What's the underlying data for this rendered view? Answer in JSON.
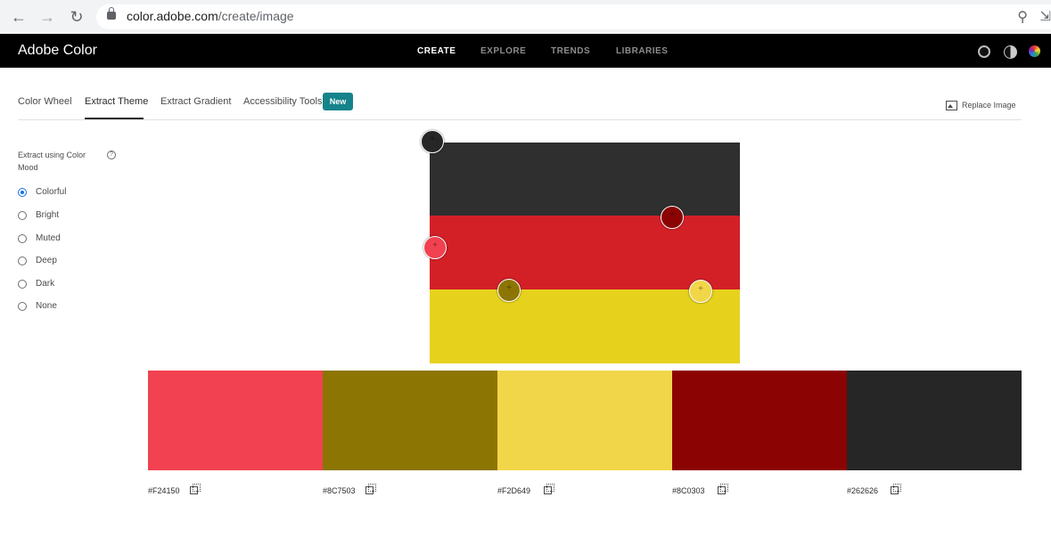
{
  "browser": {
    "url_host": "color.adobe.com",
    "url_path": "/create/image"
  },
  "app": {
    "brand": "Adobe Color",
    "nav": [
      "CREATE",
      "EXPLORE",
      "TRENDS",
      "LIBRARIES"
    ],
    "active_nav": "CREATE"
  },
  "tabs": {
    "items": [
      "Color Wheel",
      "Extract Theme",
      "Extract Gradient",
      "Accessibility Tools"
    ],
    "active": "Extract Theme",
    "badge": "New"
  },
  "replace_image_label": "Replace Image",
  "mood": {
    "label": "Extract using Color Mood",
    "options": [
      "Colorful",
      "Bright",
      "Muted",
      "Deep",
      "Dark",
      "None"
    ],
    "selected": "Colorful"
  },
  "image": {
    "stripe_colors": [
      "#2f2f2f",
      "#d32027",
      "#e6d21c"
    ]
  },
  "swatches": [
    {
      "hex": "#F24150",
      "color": "#F24150"
    },
    {
      "hex": "#8C7503",
      "color": "#8C7503"
    },
    {
      "hex": "#F2D649",
      "color": "#F2D649"
    },
    {
      "hex": "#8C0303",
      "color": "#8C0303"
    },
    {
      "hex": "#262626",
      "color": "#262626"
    }
  ]
}
